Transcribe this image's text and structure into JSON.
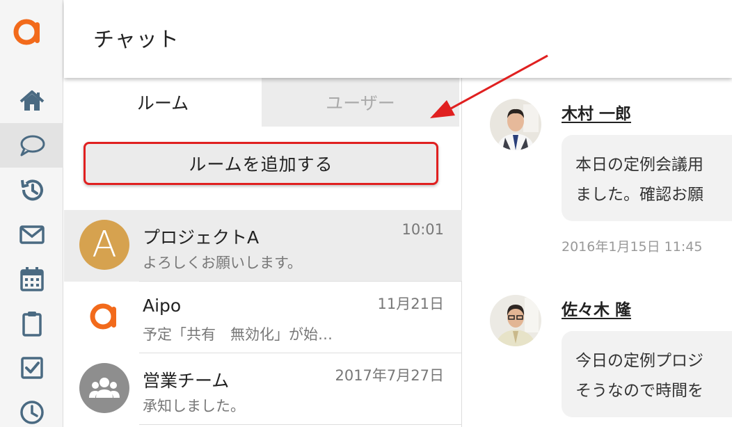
{
  "header": {
    "title": "チャット"
  },
  "tabs": [
    {
      "label": "ルーム",
      "active": true
    },
    {
      "label": "ユーザー",
      "active": false
    }
  ],
  "add_room_label": "ルームを追加する",
  "rooms": [
    {
      "name": "プロジェクトA",
      "preview": "よろしくお願いします。",
      "time": "10:01",
      "avatar_letter": "A",
      "avatar_color": "#d6a24f",
      "selected": true
    },
    {
      "name": "Aipo",
      "preview": "予定「共有　無効化」が始…",
      "time": "11月21日",
      "avatar_icon": "aipo-logo-icon",
      "selected": false
    },
    {
      "name": "営業チーム",
      "preview": "承知しました。",
      "time": "2017年7月27日",
      "avatar_icon": "group-icon",
      "selected": false
    }
  ],
  "messages": [
    {
      "sender": "木村 一郎",
      "lines": [
        "本日の定例会議用",
        "ました。確認お願"
      ],
      "timestamp": "2016年1月15日 11:45"
    },
    {
      "sender": "佐々木 隆",
      "lines": [
        "今日の定例プロジ",
        "そうなので時間を"
      ]
    }
  ],
  "rail": [
    "home-icon",
    "chat-icon",
    "history-icon",
    "mail-icon",
    "calendar-icon",
    "clipboard-icon",
    "todo-icon",
    "clock-icon"
  ],
  "colors": {
    "brand": "#f26a1b",
    "rail_icon": "#4a6a82",
    "highlight_border": "#e02020",
    "arrow": "#e02020"
  }
}
